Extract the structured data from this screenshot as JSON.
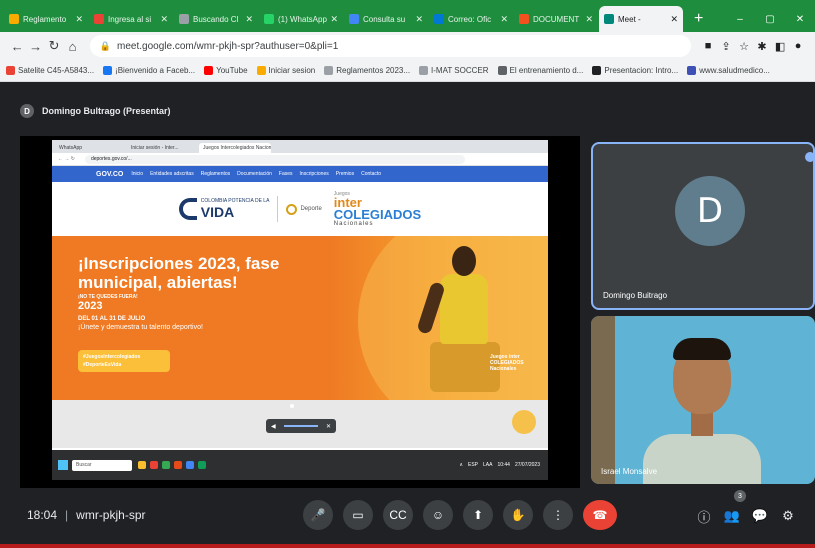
{
  "browser": {
    "tabs": [
      {
        "title": "Reglamento",
        "color": "#f9ab00"
      },
      {
        "title": "Ingresa al si",
        "color": "#ea4335"
      },
      {
        "title": "Buscando Cl",
        "color": "#9aa0a6"
      },
      {
        "title": "(1) WhatsApp",
        "color": "#25d366"
      },
      {
        "title": "Consulta su",
        "color": "#4285f4"
      },
      {
        "title": "Correo: Ofic",
        "color": "#0078d4"
      },
      {
        "title": "DOCUMENT",
        "color": "#f4511e"
      },
      {
        "title": "Meet - ",
        "color": "#00897b",
        "active": true
      }
    ],
    "new_tab": "+",
    "window_controls": [
      "–",
      "▢",
      "✕"
    ],
    "url": "meet.google.com/wmr-pkjh-spr?authuser=0&pli=1",
    "bookmarks": [
      {
        "label": "Satelite C45-A5843...",
        "color": "#ea4335"
      },
      {
        "label": "¡Bienvenido a Faceb...",
        "color": "#1877f2"
      },
      {
        "label": "YouTube",
        "color": "#ff0000"
      },
      {
        "label": "Iniciar sesion",
        "color": "#f9ab00"
      },
      {
        "label": "Reglamentos 2023...",
        "color": "#9aa0a6"
      },
      {
        "label": "I-MAT SOCCER",
        "color": "#9aa0a6"
      },
      {
        "label": "El entrenamiento d...",
        "color": "#5f6368"
      },
      {
        "label": "Presentacion: Intro...",
        "color": "#202124"
      },
      {
        "label": "www.saludmedico...",
        "color": "#3f51b5"
      }
    ]
  },
  "meet": {
    "presenter_label": "Domingo Bultrago (Presentar)",
    "presenter_initial": "D",
    "shared_screen": {
      "inner_tabs": [
        "WhatsApp",
        "Iniciar sesión - Inter...",
        "Juegos Intercolegiados Nacion..."
      ],
      "inner_url": "deportes.gov.co/...",
      "gov_bar": {
        "logo": "GOV.CO",
        "links": [
          "Inicio",
          "Entidades adscritas",
          "Reglamentos",
          "Documentación",
          "Fases",
          "Inscripciones",
          "Premios",
          "Contacto"
        ]
      },
      "logos": {
        "colombia_small": "COLOMBIA POTENCIA DE LA",
        "vida": "VIDA",
        "deporte": "Deporte",
        "juegos_small": "Juegos",
        "intercolegiados_1": "inter",
        "intercolegiados_2": "COLEGIADOS",
        "nacionales": "Nacionales"
      },
      "hero": {
        "headline": "¡Inscripciones 2023, fase municipal, abiertas!",
        "small": "¡NO TE QUEDES FUERA!",
        "year": "2023",
        "dates": "DEL 01 AL 31 DE JULIO",
        "slogan": "¡Únete y demuestra tu talento deportivo!",
        "hashtag1": "#JuegosIntercolegiados",
        "hashtag2": "#DeporteEsVida",
        "mini_logo": "Juegos inter COLEGIADOS Nacionales"
      },
      "taskbar": {
        "search": "Buscar",
        "tray": [
          "∧",
          "ESP",
          "LAA",
          "10:44",
          "27/07/2023"
        ]
      },
      "control_pill": {
        "left": "◀",
        "right": "✕"
      }
    },
    "participants": [
      {
        "name": "Domingo Buitrago",
        "initial": "D"
      },
      {
        "name": "Israel Monsalve"
      }
    ],
    "time": "18:04",
    "meeting_code": "wmr-pkjh-spr",
    "controls": [
      "🎤",
      "▭",
      "CC",
      "☺",
      "⬆",
      "✋",
      "⋮",
      "☎"
    ],
    "right_controls": [
      "ⓘ",
      "👥",
      "💬",
      "⚙"
    ],
    "people_badge": "3"
  }
}
